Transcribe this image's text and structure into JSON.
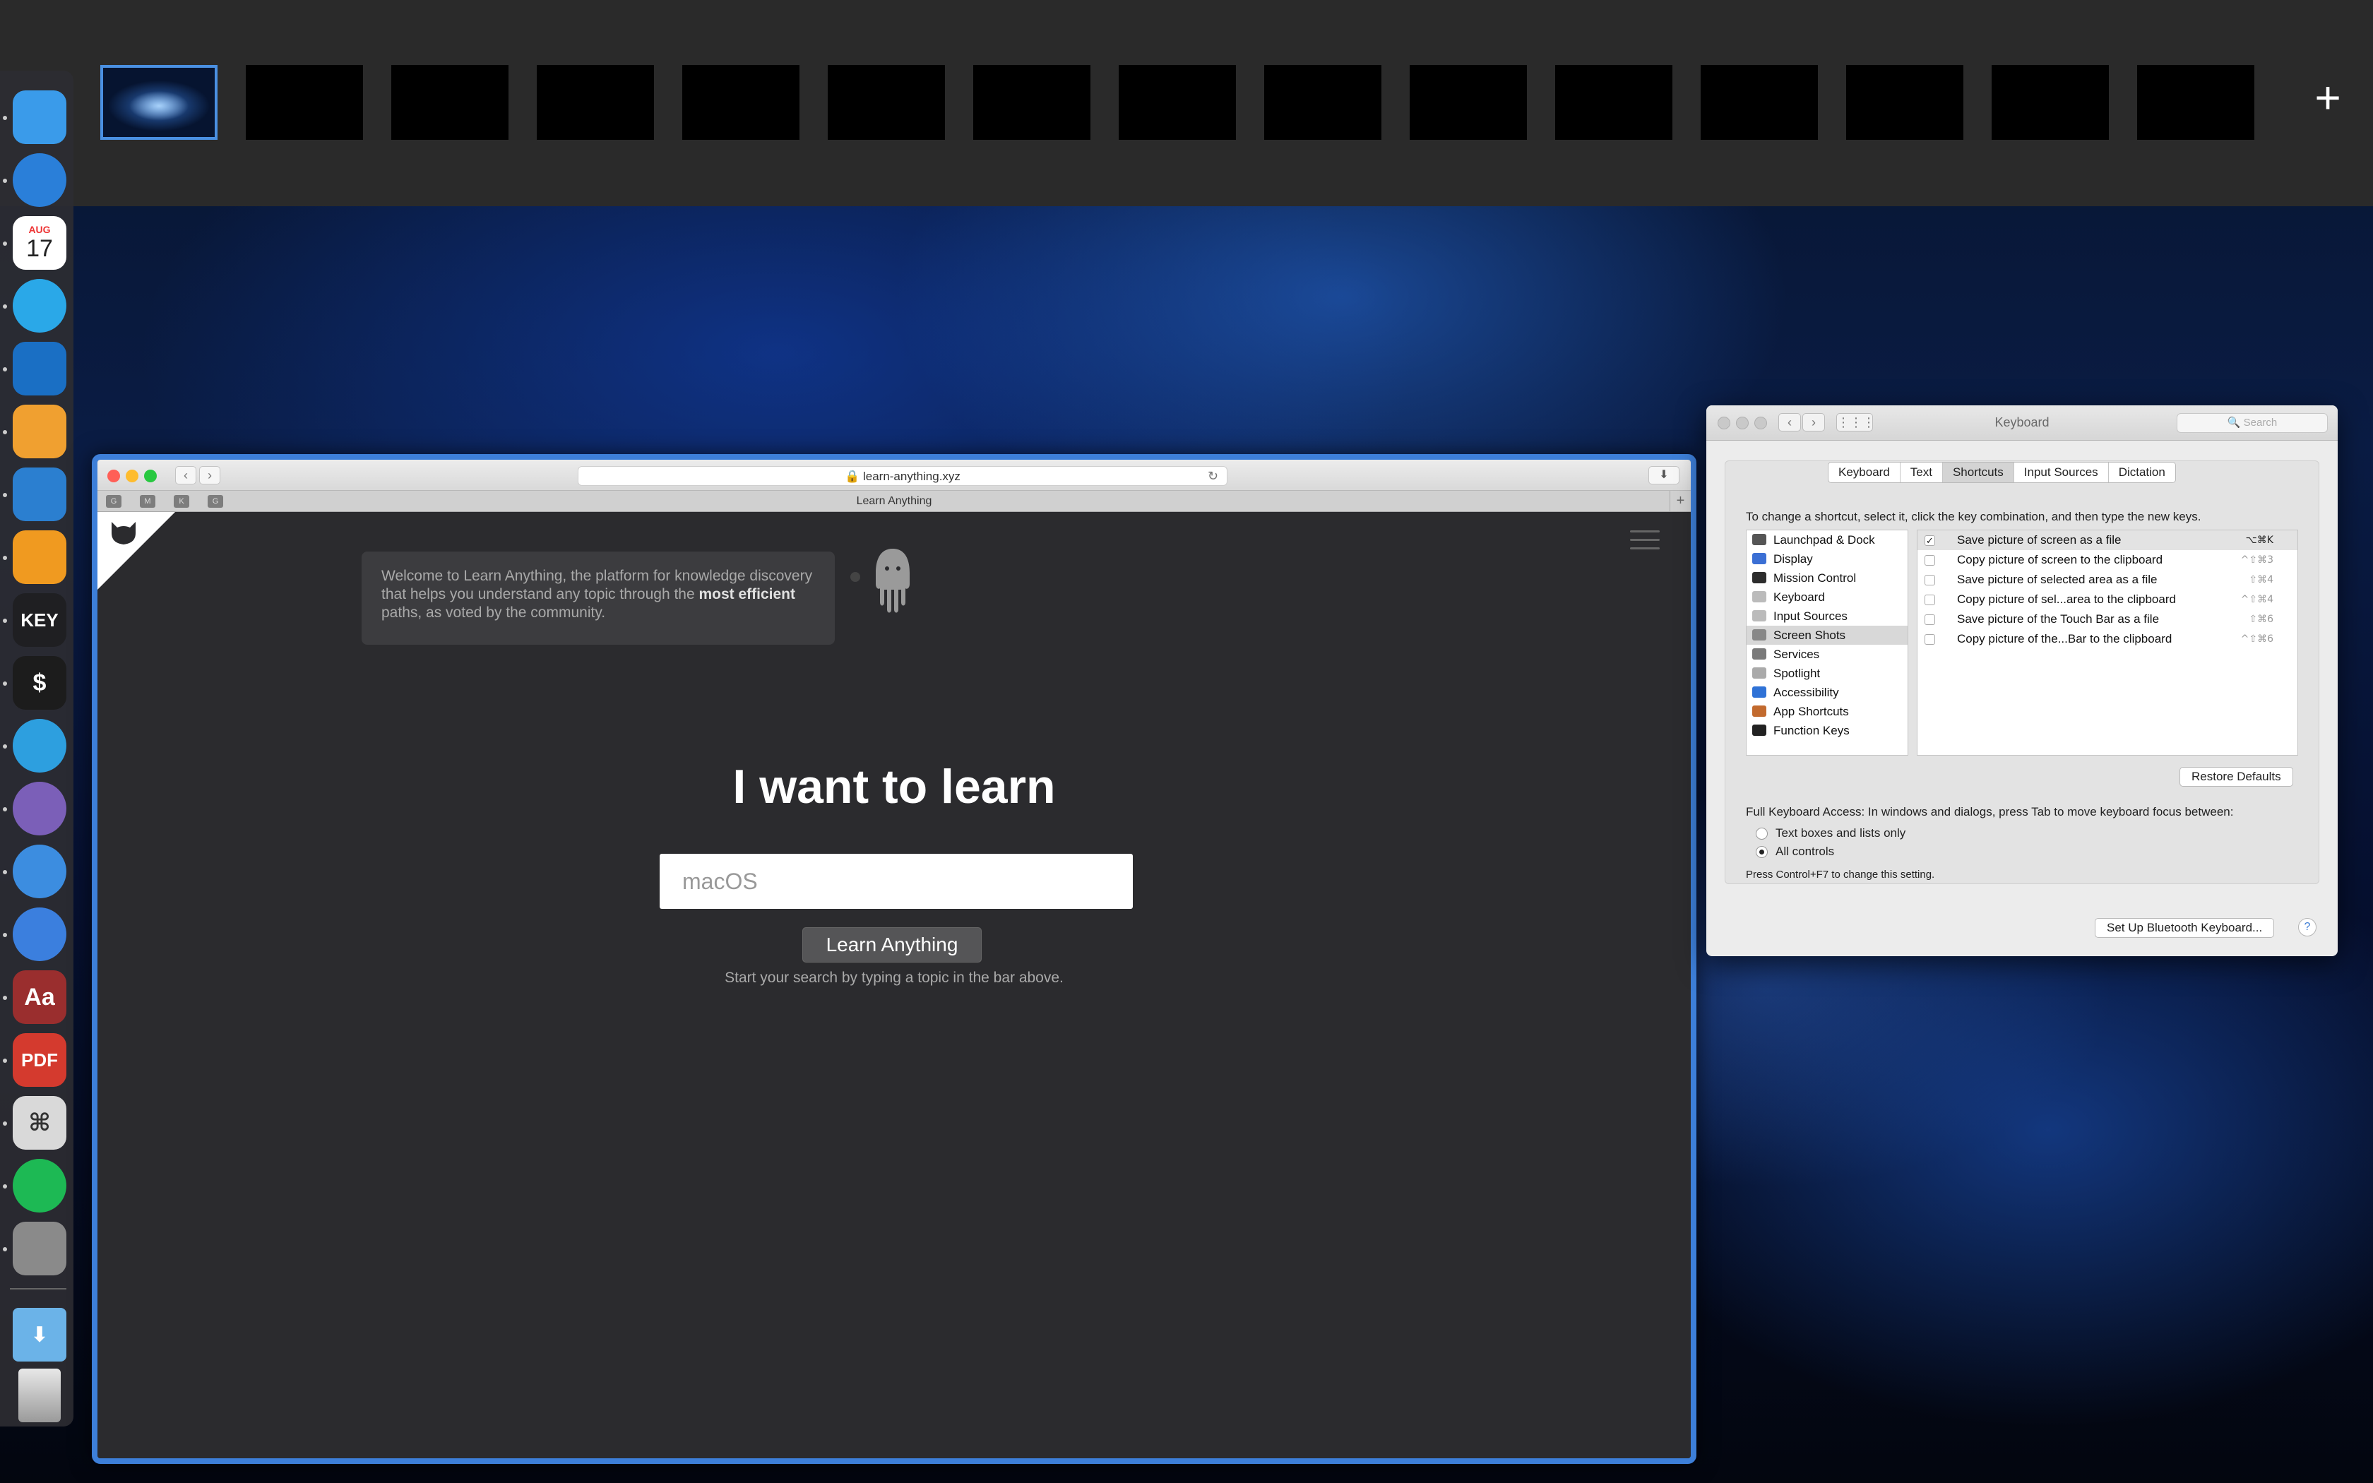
{
  "spaces": {
    "add_label": "+",
    "count": 15,
    "active_index": 0
  },
  "dock": {
    "apps": [
      {
        "name": "finder-icon",
        "label": "",
        "color": "#3a9bea"
      },
      {
        "name": "safari-icon",
        "label": "",
        "color": "#2a7fd9"
      },
      {
        "name": "calendar-icon",
        "label": "17",
        "month": "AUG",
        "color": "#ffffff"
      },
      {
        "name": "things-icon",
        "label": "",
        "color": "#2aa8e8"
      },
      {
        "name": "trello-icon",
        "label": "",
        "color": "#1a6fc4"
      },
      {
        "name": "istat-icon",
        "label": "",
        "color": "#f0a030"
      },
      {
        "name": "vscode-icon",
        "label": "",
        "color": "#2b7fd0"
      },
      {
        "name": "sublime-icon",
        "label": "",
        "color": "#f09a20"
      },
      {
        "name": "keynote-icon",
        "label": "KEY",
        "color": "#1f1f22"
      },
      {
        "name": "terminal-icon",
        "label": "$",
        "color": "#1c1c1c"
      },
      {
        "name": "telegram-icon",
        "label": "",
        "color": "#2d9fdf"
      },
      {
        "name": "tweetbot-icon",
        "label": "",
        "color": "#7b5fb8"
      },
      {
        "name": "tweetbot-bird-icon",
        "label": "",
        "color": "#3c8de0"
      },
      {
        "name": "spark-icon",
        "label": "",
        "color": "#3b7fde"
      },
      {
        "name": "dictionary-icon",
        "label": "Aa",
        "color": "#9a2e2e"
      },
      {
        "name": "pdf-icon",
        "label": "PDF",
        "color": "#d43a2e"
      },
      {
        "name": "script-editor-icon",
        "label": "⌘",
        "color": "#d9d9d9"
      },
      {
        "name": "spotify-icon",
        "label": "",
        "color": "#1db954"
      },
      {
        "name": "system-preferences-icon",
        "label": "",
        "color": "#8a8a8a"
      }
    ],
    "downloads_label": "",
    "trash_label": ""
  },
  "browser": {
    "url": "learn-anything.xyz",
    "tab_title": "Learn Anything",
    "bookmarks": [
      "G",
      "M",
      "K",
      "G"
    ],
    "welcome_pre": "Welcome to Learn Anything, the platform for knowledge discovery that helps you understand any topic through the ",
    "welcome_bold": "most efficient",
    "welcome_post": " paths, as voted by the community.",
    "headline": "I want to learn",
    "search_placeholder": "macOS",
    "search_button": "Learn Anything",
    "hint": "Start your search by typing a topic in the bar above."
  },
  "prefs": {
    "title": "Keyboard",
    "search_placeholder": "Search",
    "tabs": [
      "Keyboard",
      "Text",
      "Shortcuts",
      "Input Sources",
      "Dictation"
    ],
    "selected_tab": "Shortcuts",
    "instructions": "To change a shortcut, select it, click the key combination, and then type the new keys.",
    "categories": [
      {
        "label": "Launchpad & Dock",
        "color": "#555"
      },
      {
        "label": "Display",
        "color": "#3b6fd4"
      },
      {
        "label": "Mission Control",
        "color": "#2d2d2d"
      },
      {
        "label": "Keyboard",
        "color": "#bbbbbb"
      },
      {
        "label": "Input Sources",
        "color": "#bbbbbb"
      },
      {
        "label": "Screen Shots",
        "color": "#888888"
      },
      {
        "label": "Services",
        "color": "#7a7a7a"
      },
      {
        "label": "Spotlight",
        "color": "#aaaaaa"
      },
      {
        "label": "Accessibility",
        "color": "#2f72d6"
      },
      {
        "label": "App Shortcuts",
        "color": "#c26a2e"
      },
      {
        "label": "Function Keys",
        "color": "#222222"
      }
    ],
    "selected_category": "Screen Shots",
    "shortcuts": [
      {
        "label": "Save picture of screen as a file",
        "keys": "⌥⌘K",
        "checked": true
      },
      {
        "label": "Copy picture of screen to the clipboard",
        "keys": "^⇧⌘3",
        "checked": false
      },
      {
        "label": "Save picture of selected area as a file",
        "keys": "⇧⌘4",
        "checked": false
      },
      {
        "label": "Copy picture of sel...area to the clipboard",
        "keys": "^⇧⌘4",
        "checked": false
      },
      {
        "label": "Save picture of the Touch Bar as a file",
        "keys": "⇧⌘6",
        "checked": false
      },
      {
        "label": "Copy picture of the...Bar to the clipboard",
        "keys": "^⇧⌘6",
        "checked": false
      }
    ],
    "restore_defaults": "Restore Defaults",
    "full_keyboard_access": "Full Keyboard Access: In windows and dialogs, press Tab to move keyboard focus between:",
    "radio_options": [
      "Text boxes and lists only",
      "All controls"
    ],
    "radio_selected": "All controls",
    "ctrl_note": "Press Control+F7 to change this setting.",
    "bluetooth_button": "Set Up Bluetooth Keyboard...",
    "help_label": "?"
  }
}
